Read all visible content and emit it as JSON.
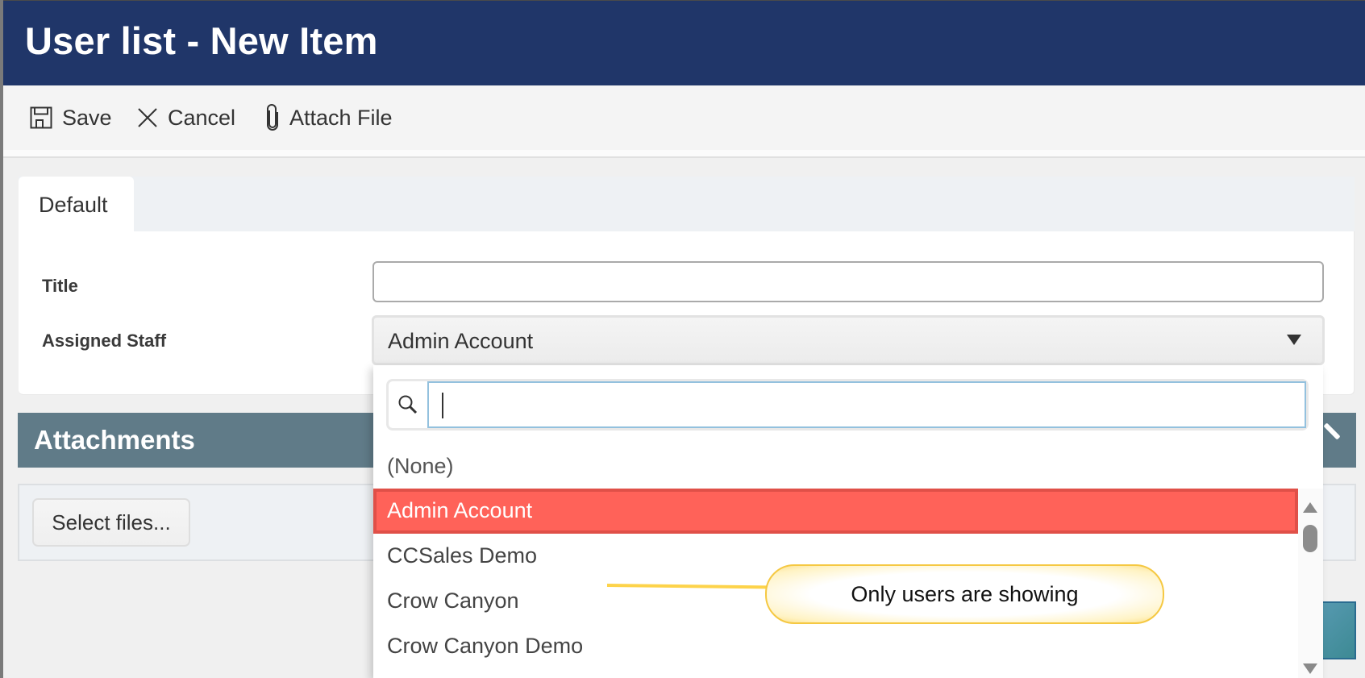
{
  "header": {
    "title": "User list - New Item"
  },
  "toolbar": {
    "save_label": "Save",
    "cancel_label": "Cancel",
    "attach_label": "Attach File"
  },
  "tabs": [
    {
      "label": "Default",
      "active": true
    }
  ],
  "form": {
    "title_label": "Title",
    "title_value": "",
    "assigned_staff_label": "Assigned Staff",
    "assigned_staff_value": "Admin Account"
  },
  "dropdown": {
    "search_value": "",
    "options": [
      {
        "label": "(None)",
        "selected": false
      },
      {
        "label": "Admin Account",
        "selected": true
      },
      {
        "label": "CCSales Demo",
        "selected": false
      },
      {
        "label": "Crow Canyon",
        "selected": false
      },
      {
        "label": "Crow Canyon Demo",
        "selected": false
      }
    ]
  },
  "attachments": {
    "title": "Attachments",
    "select_files_label": "Select files..."
  },
  "annotation": {
    "text": "Only users are showing"
  },
  "colors": {
    "header_bg": "#203669",
    "selected_option": "#ff6259",
    "attachments_header": "#607b88",
    "callout_border": "#f5c842"
  }
}
